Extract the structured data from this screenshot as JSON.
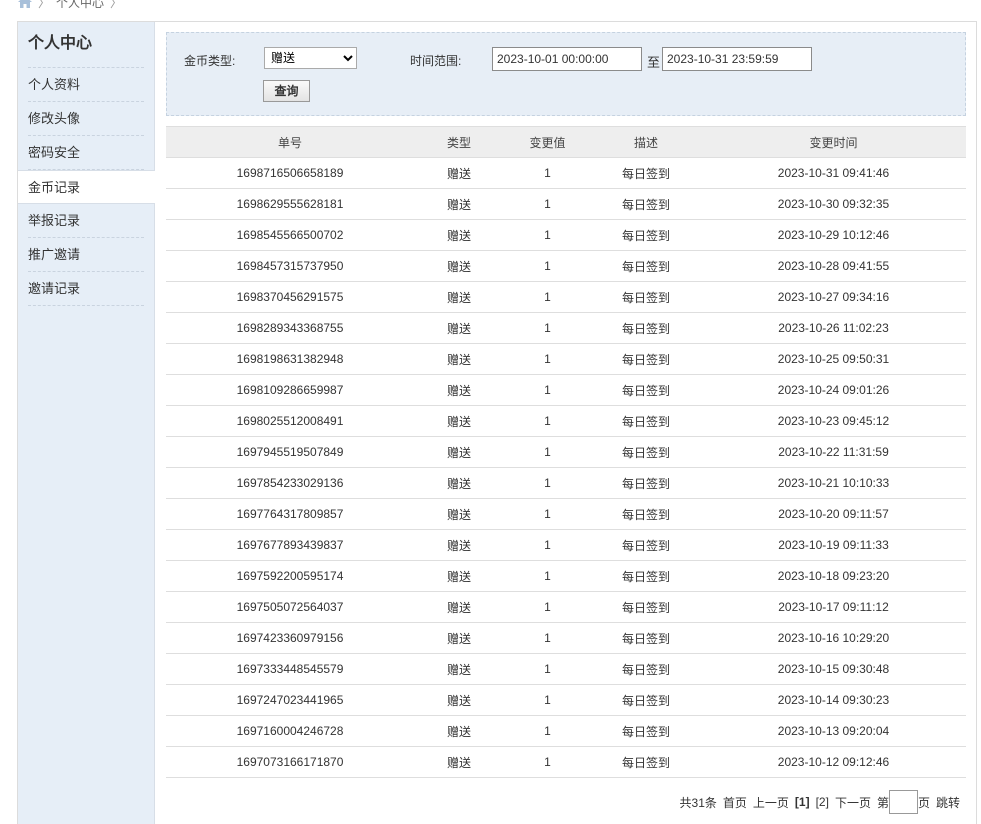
{
  "breadcrumb": {
    "home_icon": "home-icon",
    "current": "个人中心",
    "sep": "〉"
  },
  "sidebar": {
    "title": "个人中心",
    "items": [
      {
        "label": "个人资料",
        "active": false
      },
      {
        "label": "修改头像",
        "active": false
      },
      {
        "label": "密码安全",
        "active": false
      },
      {
        "label": "金币记录",
        "active": true
      },
      {
        "label": "举报记录",
        "active": false
      },
      {
        "label": "推广邀请",
        "active": false
      },
      {
        "label": "邀请记录",
        "active": false
      }
    ]
  },
  "filter": {
    "type_label": "金币类型:",
    "type_value": "赠送",
    "time_label": "时间范围:",
    "start_time": "2023-10-01 00:00:00",
    "to_label": "至",
    "end_time": "2023-10-31 23:59:59",
    "query_button": "查询"
  },
  "table": {
    "headers": [
      "单号",
      "类型",
      "变更值",
      "描述",
      "变更时间"
    ],
    "rows": [
      [
        "1698716506658189",
        "赠送",
        "1",
        "每日签到",
        "2023-10-31 09:41:46"
      ],
      [
        "1698629555628181",
        "赠送",
        "1",
        "每日签到",
        "2023-10-30 09:32:35"
      ],
      [
        "1698545566500702",
        "赠送",
        "1",
        "每日签到",
        "2023-10-29 10:12:46"
      ],
      [
        "1698457315737950",
        "赠送",
        "1",
        "每日签到",
        "2023-10-28 09:41:55"
      ],
      [
        "1698370456291575",
        "赠送",
        "1",
        "每日签到",
        "2023-10-27 09:34:16"
      ],
      [
        "1698289343368755",
        "赠送",
        "1",
        "每日签到",
        "2023-10-26 11:02:23"
      ],
      [
        "1698198631382948",
        "赠送",
        "1",
        "每日签到",
        "2023-10-25 09:50:31"
      ],
      [
        "1698109286659987",
        "赠送",
        "1",
        "每日签到",
        "2023-10-24 09:01:26"
      ],
      [
        "1698025512008491",
        "赠送",
        "1",
        "每日签到",
        "2023-10-23 09:45:12"
      ],
      [
        "1697945519507849",
        "赠送",
        "1",
        "每日签到",
        "2023-10-22 11:31:59"
      ],
      [
        "1697854233029136",
        "赠送",
        "1",
        "每日签到",
        "2023-10-21 10:10:33"
      ],
      [
        "1697764317809857",
        "赠送",
        "1",
        "每日签到",
        "2023-10-20 09:11:57"
      ],
      [
        "1697677893439837",
        "赠送",
        "1",
        "每日签到",
        "2023-10-19 09:11:33"
      ],
      [
        "1697592200595174",
        "赠送",
        "1",
        "每日签到",
        "2023-10-18 09:23:20"
      ],
      [
        "1697505072564037",
        "赠送",
        "1",
        "每日签到",
        "2023-10-17 09:11:12"
      ],
      [
        "1697423360979156",
        "赠送",
        "1",
        "每日签到",
        "2023-10-16 10:29:20"
      ],
      [
        "1697333448545579",
        "赠送",
        "1",
        "每日签到",
        "2023-10-15 09:30:48"
      ],
      [
        "1697247023441965",
        "赠送",
        "1",
        "每日签到",
        "2023-10-14 09:30:23"
      ],
      [
        "1697160004246728",
        "赠送",
        "1",
        "每日签到",
        "2023-10-13 09:20:04"
      ],
      [
        "1697073166171870",
        "赠送",
        "1",
        "每日签到",
        "2023-10-12 09:12:46"
      ]
    ]
  },
  "pager": {
    "total": "共31条",
    "first": "首页",
    "prev": "上一页",
    "current": "[1]",
    "page2": "[2]",
    "next": "下一页",
    "goto_prefix": "第",
    "goto_suffix": "页",
    "jump": "跳转"
  }
}
